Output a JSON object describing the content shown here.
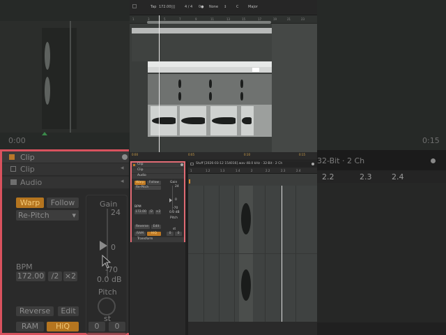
{
  "left_zoom": {
    "timeline_start": "0:00",
    "panel_title": "Clip",
    "clip_label": "Clip",
    "audio_label": "Audio",
    "warp": "Warp",
    "follow": "Follow",
    "warp_mode": "Re-Pitch",
    "gain_label": "Gain",
    "gain_top": "24",
    "gain_zero": "0",
    "gain_bottom": "-70",
    "gain_db": "0.0 dB",
    "bpm_label": "BPM",
    "bpm_value": "172.00",
    "half": "/2",
    "double": "×2",
    "pitch_label": "Pitch",
    "st": "st",
    "reverse": "Reverse",
    "edit": "Edit",
    "ram": "RAM",
    "hiq": "HiQ",
    "st_left": "0",
    "st_right": "0"
  },
  "right_zoom": {
    "timeline_end": "0:15",
    "file_info": "32-Bit · 2 Ch",
    "ruler": [
      "2.2",
      "2.3",
      "2.4"
    ]
  },
  "toolbar": {
    "tap": "Tap",
    "tempo": "172.00",
    "meter_icon": "|||",
    "signature": "4 / 4",
    "metro": "0●",
    "quantize": "None",
    "key_icon": "↕",
    "key_value": "C",
    "scale": "Major"
  },
  "arrangement": {
    "ruler": [
      "1",
      "3",
      "5",
      "7",
      "9",
      "11",
      "13",
      "15",
      "17",
      "19",
      "21",
      "23"
    ],
    "time_labels": [
      "0:00",
      "0:05",
      "0:10",
      "0:15"
    ]
  },
  "clip_panel": {
    "title": "Clip",
    "clip": "Clip",
    "audio": "Audio",
    "warp": "Warp",
    "follow": "Follow",
    "mode": "Re-Pitch",
    "gain": "Gain",
    "gain_top": "24",
    "gain_zero": "0",
    "gain_bottom": "-70",
    "gain_db": "0.0 dB",
    "bpm": "BPM",
    "bpm_value": "172.00",
    "half": "/2",
    "double": "×2",
    "pitch": "Pitch",
    "reverse": "Reverse",
    "edit": "Edit",
    "ram": "RAM",
    "hiq": "HiQ",
    "st": "st",
    "st_left": "0",
    "st_right": "0",
    "transform": "Transform"
  },
  "sample_editor": {
    "file": "Stuff [2026-03-12 154016].wav  48.0 kHz · 32-Bit · 2 Ch",
    "ruler": [
      "1",
      "1.2",
      "1.3",
      "1.4",
      "2",
      "2.2",
      "2.3",
      "2.4"
    ]
  },
  "colors": {
    "accent_red": "#d9525e",
    "warp_orange": "#b5751f"
  }
}
